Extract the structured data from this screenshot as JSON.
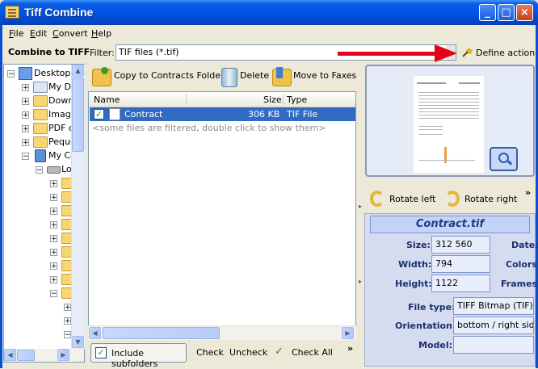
{
  "window": {
    "title": "Tiff Combine"
  },
  "menu": [
    "File",
    "Edit",
    "Convert",
    "Help"
  ],
  "toolbar": {
    "section_label": "Combine to TIFF",
    "filter_label": "Filter:",
    "filter_value": "TIF files (*.tif)",
    "define_action": "Define action"
  },
  "tree": {
    "items": [
      {
        "label": "Desktop"
      },
      {
        "label": "My Dr"
      },
      {
        "label": "Down"
      },
      {
        "label": "Image"
      },
      {
        "label": "PDF c"
      },
      {
        "label": "Peque"
      },
      {
        "label": "My Co"
      },
      {
        "label": "Lo"
      }
    ]
  },
  "actions": {
    "copy": "Copy to Contracts Folder",
    "delete": "Delete",
    "move": "Move to Faxes"
  },
  "list": {
    "headers": {
      "name": "Name",
      "size": "Size",
      "type": "Type"
    },
    "files": [
      {
        "name": "Contract",
        "size": "306 KB",
        "type": "TIF File",
        "checked": true
      }
    ],
    "filtered_note": "<some files are filtered, double click to show them>"
  },
  "bottom": {
    "include_subfolders": "Include subfolders",
    "check": "Check",
    "uncheck": "Uncheck",
    "check_all": "Check All",
    "more": "»"
  },
  "preview": {
    "rotate_left": "Rotate left",
    "rotate_right": "Rotate right",
    "more": "»"
  },
  "info": {
    "filename": "Contract.tif",
    "size_label": "Size:",
    "size_value": "312 560",
    "width_label": "Width:",
    "width_value": "794",
    "height_label": "Height:",
    "height_value": "1122",
    "date_label": "Date:",
    "colors_label": "Colors:",
    "frames_label": "Frames:",
    "filetype_label": "File type:",
    "filetype_value": "TIFF Bitmap (TIF) LZW",
    "orientation_label": "Orientation:",
    "orientation_value": "bottom / right side",
    "model_label": "Model:",
    "model_value": ""
  }
}
